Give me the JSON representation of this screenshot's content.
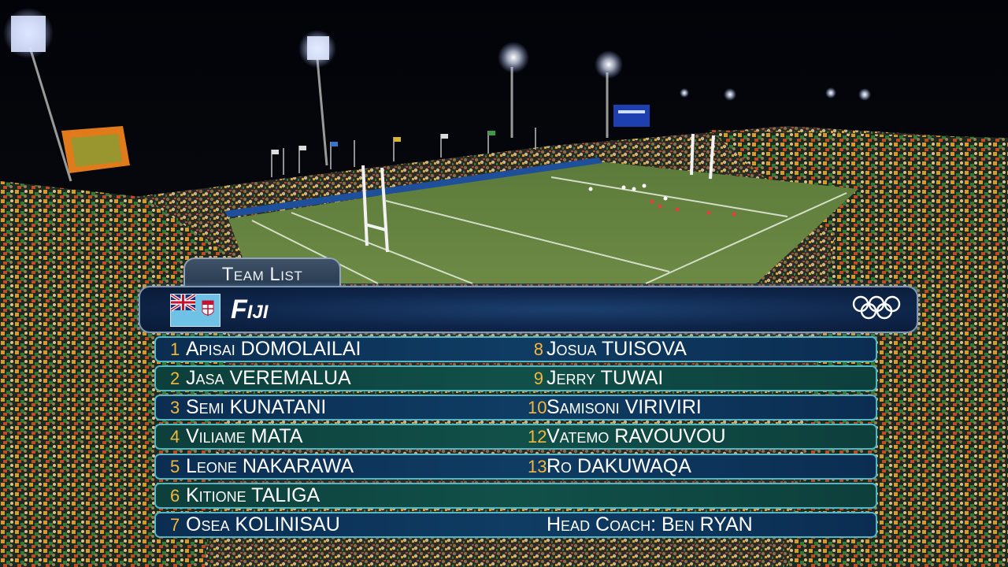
{
  "overlay": {
    "tab_label": "Team List",
    "team": "Fiji",
    "left_column": [
      {
        "number": "1",
        "name": "Apisai DOMOLAILAI"
      },
      {
        "number": "2",
        "name": "Jasa VEREMALUA"
      },
      {
        "number": "3",
        "name": "Semi KUNATANI"
      },
      {
        "number": "4",
        "name": "Viliame MATA"
      },
      {
        "number": "5",
        "name": "Leone NAKARAWA"
      },
      {
        "number": "6",
        "name": "Kitione TALIGA"
      },
      {
        "number": "7",
        "name": "Osea KOLINISAU"
      }
    ],
    "right_column": [
      {
        "number": "8",
        "name": "Josua TUISOVA"
      },
      {
        "number": "9",
        "name": "Jerry TUWAI"
      },
      {
        "number": "10",
        "name": "Samisoni VIRIVIRI"
      },
      {
        "number": "12",
        "name": "Vatemo RAVOUVOU"
      },
      {
        "number": "13",
        "name": "Ro DAKUWAQA"
      }
    ],
    "coach": "Head Coach: Ben RYAN",
    "colors": {
      "number": "#f4b73a",
      "row_border": "#4fb7c6",
      "header_bg": "#0e2448"
    },
    "icons": [
      "fiji-flag-icon",
      "olympic-rings-icon"
    ]
  }
}
